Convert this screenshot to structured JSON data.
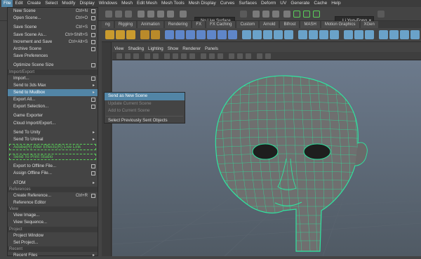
{
  "menubar": [
    "File",
    "Edit",
    "Create",
    "Select",
    "Modify",
    "Display",
    "Windows",
    "Mesh",
    "Edit Mesh",
    "Mesh Tools",
    "Mesh Display",
    "Curves",
    "Surfaces",
    "Deform",
    "UV",
    "Generate",
    "Cache",
    "Help"
  ],
  "toolbar": {
    "live_surface": "No Live Surface",
    "user": "Li Yun-Fong"
  },
  "shelf_tabs": [
    "ng",
    "Rigging",
    "Animation",
    "Rendering",
    "FX",
    "FX Caching",
    "Custom",
    "Arnold",
    "Bifrost",
    "MASH",
    "Motion Graphics",
    "XGen"
  ],
  "viewport_menu": [
    "View",
    "Shading",
    "Lighting",
    "Show",
    "Renderer",
    "Panels"
  ],
  "file_menu": [
    {
      "type": "item",
      "label": "New Scene",
      "shortcut": "Ctrl+N",
      "option": true
    },
    {
      "type": "item",
      "label": "Open Scene...",
      "shortcut": "Ctrl+O",
      "option": true
    },
    {
      "type": "gap"
    },
    {
      "type": "item",
      "label": "Save Scene",
      "shortcut": "Ctrl+S",
      "option": true
    },
    {
      "type": "item",
      "label": "Save Scene As...",
      "shortcut": "Ctrl+Shift+S",
      "option": true
    },
    {
      "type": "item",
      "label": "Increment and Save",
      "shortcut": "Ctrl+Alt+S",
      "option": true
    },
    {
      "type": "item",
      "label": "Archive Scene",
      "option": true
    },
    {
      "type": "item",
      "label": "Save Preferences"
    },
    {
      "type": "gap"
    },
    {
      "type": "item",
      "label": "Optimize Scene Size",
      "option": true
    },
    {
      "type": "section",
      "label": "Import/Export"
    },
    {
      "type": "item",
      "label": "Import...",
      "option": true
    },
    {
      "type": "item",
      "label": "Send to 3ds Max",
      "arrow": true
    },
    {
      "type": "item",
      "label": "Send to Mudbox",
      "arrow": true,
      "highlight": true
    },
    {
      "type": "item",
      "label": "Export All...",
      "option": true
    },
    {
      "type": "item",
      "label": "Export Selection...",
      "option": true
    },
    {
      "type": "gap"
    },
    {
      "type": "item",
      "label": "Game Exporter"
    },
    {
      "type": "item",
      "label": "Cloud Import/Export..."
    },
    {
      "type": "gap"
    },
    {
      "type": "item",
      "label": "Send To Unity",
      "arrow": true
    },
    {
      "type": "item",
      "label": "Send To Unreal",
      "arrow": true
    },
    {
      "type": "green",
      "label": "Adobe(R) After Effects(R) Live Link"
    },
    {
      "type": "gap"
    },
    {
      "type": "green",
      "label": "Send To Print Studio"
    },
    {
      "type": "gap"
    },
    {
      "type": "item",
      "label": "Export to Offline File...",
      "option": true
    },
    {
      "type": "item",
      "label": "Assign Offline File...",
      "option": true
    },
    {
      "type": "gap"
    },
    {
      "type": "item",
      "label": "ATOM",
      "arrow": true
    },
    {
      "type": "section",
      "label": "References"
    },
    {
      "type": "item",
      "label": "Create Reference...",
      "shortcut": "Ctrl+R",
      "option": true
    },
    {
      "type": "item",
      "label": "Reference Editor"
    },
    {
      "type": "section",
      "label": "View"
    },
    {
      "type": "item",
      "label": "View Image..."
    },
    {
      "type": "item",
      "label": "View Sequence..."
    },
    {
      "type": "section",
      "label": "Project"
    },
    {
      "type": "item",
      "label": "Project Window"
    },
    {
      "type": "item",
      "label": "Set Project..."
    },
    {
      "type": "section",
      "label": "Recent"
    },
    {
      "type": "item",
      "label": "Recent Files",
      "arrow": true
    }
  ],
  "submenu": [
    {
      "label": "Send as New Scene",
      "highlight": true
    },
    {
      "label": "Update Current Scene",
      "disabled": true
    },
    {
      "label": "Add to Current Scene",
      "disabled": true
    },
    {
      "sep": true
    },
    {
      "label": "Select Previously Sent Objects"
    }
  ],
  "colors": {
    "highlight": "#5285a6",
    "wire": "#2ee6a0",
    "green_tag": "#5ad15a"
  }
}
